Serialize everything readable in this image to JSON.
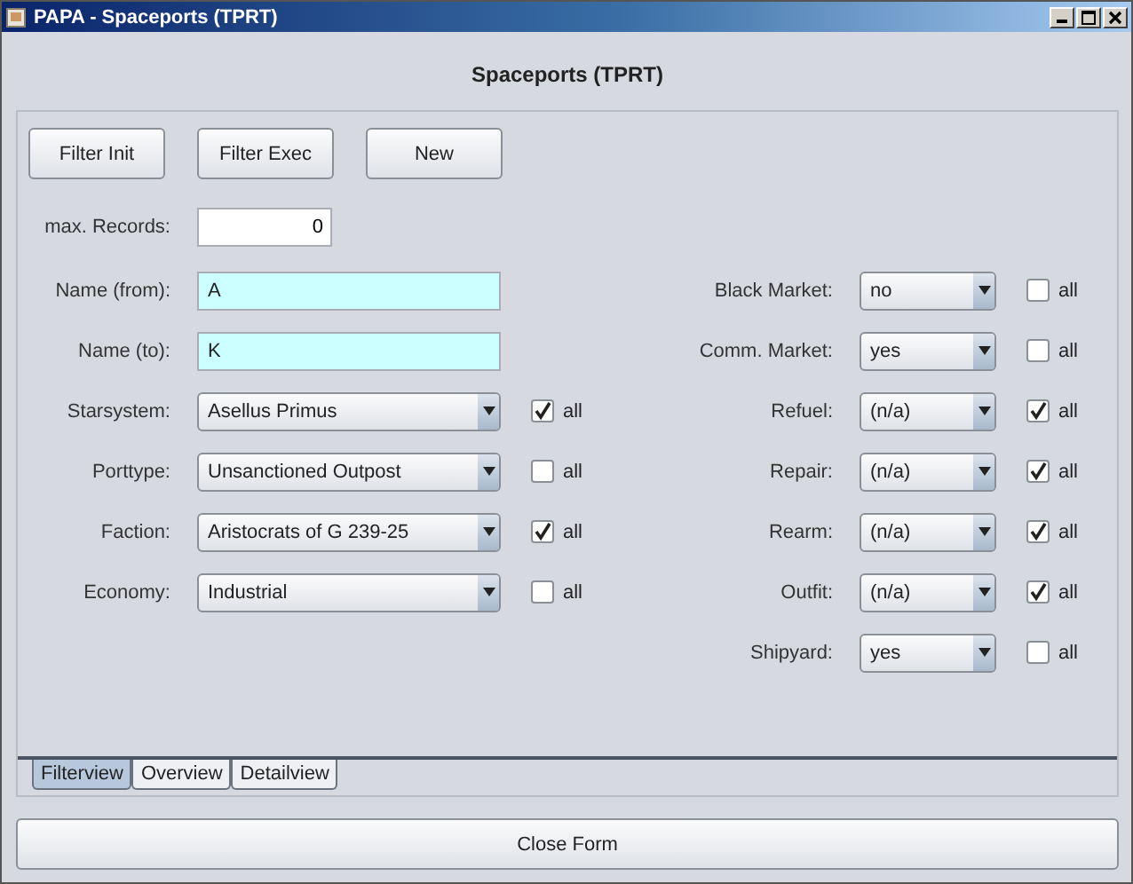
{
  "window": {
    "title": "PAPA - Spaceports (TPRT)"
  },
  "heading": "Spaceports (TPRT)",
  "toolbar": [
    "Filter Init",
    "Filter Exec",
    "New"
  ],
  "max_records": {
    "label": "max. Records:",
    "value": "0"
  },
  "left_fields": [
    {
      "kind": "text",
      "label": "Name (from):",
      "value": "A"
    },
    {
      "kind": "text",
      "label": "Name (to):",
      "value": "K"
    },
    {
      "kind": "combo",
      "label": "Starsystem:",
      "value": "Asellus Primus",
      "all_label": "all",
      "all_checked": true
    },
    {
      "kind": "combo",
      "label": "Porttype:",
      "value": "Unsanctioned Outpost",
      "all_label": "all",
      "all_checked": false
    },
    {
      "kind": "combo",
      "label": "Faction:",
      "value": "Aristocrats of G 239-25",
      "all_label": "all",
      "all_checked": true
    },
    {
      "kind": "combo",
      "label": "Economy:",
      "value": "Industrial",
      "all_label": "all",
      "all_checked": false
    }
  ],
  "right_fields": [
    {
      "kind": "combo",
      "label": "Black Market:",
      "value": "no",
      "all_label": "all",
      "all_checked": false
    },
    {
      "kind": "combo",
      "label": "Comm. Market:",
      "value": "yes",
      "all_label": "all",
      "all_checked": false
    },
    {
      "kind": "combo",
      "label": "Refuel:",
      "value": "(n/a)",
      "all_label": "all",
      "all_checked": true
    },
    {
      "kind": "combo",
      "label": "Repair:",
      "value": "(n/a)",
      "all_label": "all",
      "all_checked": true
    },
    {
      "kind": "combo",
      "label": "Rearm:",
      "value": "(n/a)",
      "all_label": "all",
      "all_checked": true
    },
    {
      "kind": "combo",
      "label": "Outfit:",
      "value": "(n/a)",
      "all_label": "all",
      "all_checked": true
    },
    {
      "kind": "combo",
      "label": "Shipyard:",
      "value": "yes",
      "all_label": "all",
      "all_checked": false
    }
  ],
  "tabs": [
    {
      "label": "Filterview",
      "selected": true
    },
    {
      "label": "Overview",
      "selected": false
    },
    {
      "label": "Detailview",
      "selected": false
    }
  ],
  "close_button": "Close Form"
}
